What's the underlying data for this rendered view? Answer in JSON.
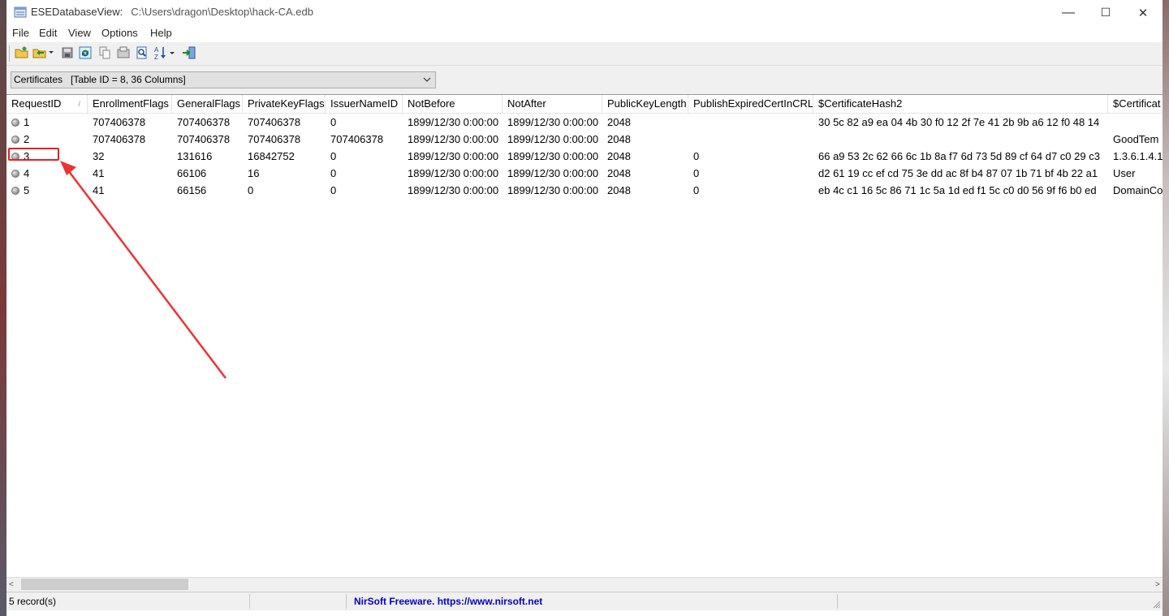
{
  "window": {
    "app_name": "ESEDatabaseView:",
    "file_path": "C:\\Users\\dragon\\Desktop\\hack-CA.edb",
    "minimize": "—",
    "maximize": "☐",
    "close": "✕"
  },
  "menu": [
    "File",
    "Edit",
    "View",
    "Options",
    "Help"
  ],
  "toolbar": {
    "icons": [
      "open-folder-icon",
      "open-dropdown-icon",
      "save-icon",
      "refresh-icon",
      "copy-icon",
      "properties-icon",
      "find-icon",
      "sort-icon",
      "exit-icon"
    ]
  },
  "table_selector": {
    "value": "Certificates   [Table ID = 8, 36 Columns]"
  },
  "columns": [
    {
      "label": "RequestID",
      "sort": "/"
    },
    {
      "label": "EnrollmentFlags"
    },
    {
      "label": "GeneralFlags"
    },
    {
      "label": "PrivateKeyFlags"
    },
    {
      "label": "IssuerNameID"
    },
    {
      "label": "NotBefore"
    },
    {
      "label": "NotAfter"
    },
    {
      "label": "PublicKeyLength"
    },
    {
      "label": "PublishExpiredCertInCRL"
    },
    {
      "label": "$CertificateHash2"
    },
    {
      "label": "$Certificat"
    }
  ],
  "rows": [
    [
      "1",
      "707406378",
      "707406378",
      "707406378",
      "0",
      "1899/12/30 0:00:00",
      "1899/12/30 0:00:00",
      "2048",
      "",
      "30 5c 82 a9 ea 04 4b 30 f0 12 2f 7e 41 2b 9b a6 12 f0 48 14",
      ""
    ],
    [
      "2",
      "707406378",
      "707406378",
      "707406378",
      "707406378",
      "1899/12/30 0:00:00",
      "1899/12/30 0:00:00",
      "2048",
      "",
      "",
      "GoodTem"
    ],
    [
      "3",
      "32",
      "131616",
      "16842752",
      "0",
      "1899/12/30 0:00:00",
      "1899/12/30 0:00:00",
      "2048",
      "0",
      "66 a9 53 2c 62 66 6c 1b 8a f7 6d 73 5d 89 cf 64 d7 c0 29 c3",
      "1.3.6.1.4.1."
    ],
    [
      "4",
      "41",
      "66106",
      "16",
      "0",
      "1899/12/30 0:00:00",
      "1899/12/30 0:00:00",
      "2048",
      "0",
      "d2 61 19 cc ef cd 75 3e dd ac 8f b4 87 07 1b 71 bf 4b 22 a1",
      "User"
    ],
    [
      "5",
      "41",
      "66156",
      "0",
      "0",
      "1899/12/30 0:00:00",
      "1899/12/30 0:00:00",
      "2048",
      "0",
      "eb 4c c1 16 5c 86 71 1c 5a 1d ed f1 5c c0 d0 56 9f f6 b0 ed",
      "DomainCo"
    ]
  ],
  "status": {
    "records": "5 record(s)",
    "credit": "NirSoft Freeware. https://www.nirsoft.net"
  },
  "annotation": {
    "highlighted_row": "3",
    "color": "#e52020"
  }
}
